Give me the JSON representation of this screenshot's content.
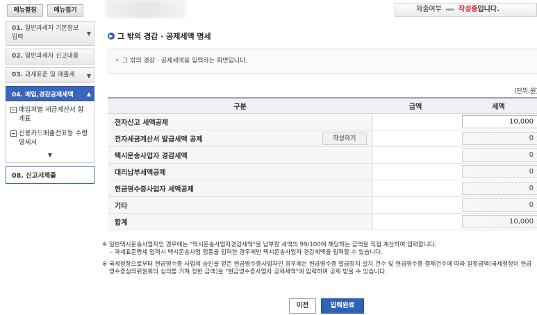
{
  "sidebar": {
    "top_buttons": {
      "expand": "메뉴펼침",
      "collapse": "메뉴접기"
    },
    "items": [
      {
        "num": "01.",
        "label": "일반과세자 기본정보 입력"
      },
      {
        "num": "02.",
        "label": "일반과세자 신고내용"
      },
      {
        "num": "03.",
        "label": "과세표준 및 매출세"
      },
      {
        "num": "04.",
        "label": "매입,경감공제세액"
      }
    ],
    "sub_items": [
      {
        "label": "매입처별 세금계산서 합계표"
      },
      {
        "label": "신용카드매출전표등 수령명세서"
      }
    ],
    "final": {
      "num": "08.",
      "label": "신고서제출"
    }
  },
  "status": {
    "label": "제출여부",
    "arrows": "▸▸▸▸",
    "value": "작성중",
    "suffix": "입니다."
  },
  "section": {
    "title": "그 밖의 경감 · 공제세액 명세",
    "info": "그 밖의 경감 · 공제세액을 입력하는 화면입니다.",
    "unit": "(단위:원)"
  },
  "table": {
    "headers": {
      "category": "구분",
      "amount": "금액",
      "tax": "세액"
    },
    "rows": [
      {
        "label": "전자신고 세액공제",
        "tax": "10,000"
      },
      {
        "label": "전자세금계산서 발급세액 공제",
        "button": "작성하기",
        "tax": "0"
      },
      {
        "label": "택시운송사업자 경감세액",
        "tax": "0"
      },
      {
        "label": "대리납부세액공제",
        "tax": "0"
      },
      {
        "label": "현금영수증사업자 세액공제",
        "tax": "0"
      },
      {
        "label": "기타",
        "tax": "0"
      },
      {
        "label": "합계",
        "tax": "10,000"
      }
    ]
  },
  "notes": {
    "n1": "※ 일반택시운송사업자인 경우에는 \"택시운송사업자경감세액\"을 납부할 세액의 99/100에 해당하는 금액을 직접 계산하여 입력합니다.",
    "n1_sub": "- 과세표준명세 입력시 택시운송사업 업종을 입력한 경우에만 택시운송사업자 경감세액을 입력할 수 있습니다.",
    "n2": "※ 국세청장으로부터 현금영수증 사업의 승인을 얻은 현금영수증사업자인 경우에는 현금영수증 발급장치 설치 건수 및 현금영수증 결제건수에 따라 일정금액(국세청장이 현금영수증심의위원회의 심의를 거쳐 정한 금액)을 \"현금영수증사업자 공제세액\"에 입력하여 공제 받을 수 있습니다."
  },
  "buttons": {
    "prev": "이전",
    "done": "입력완료"
  },
  "colors": {
    "accent": "#3a66b8",
    "status_red": "#d0202a"
  }
}
